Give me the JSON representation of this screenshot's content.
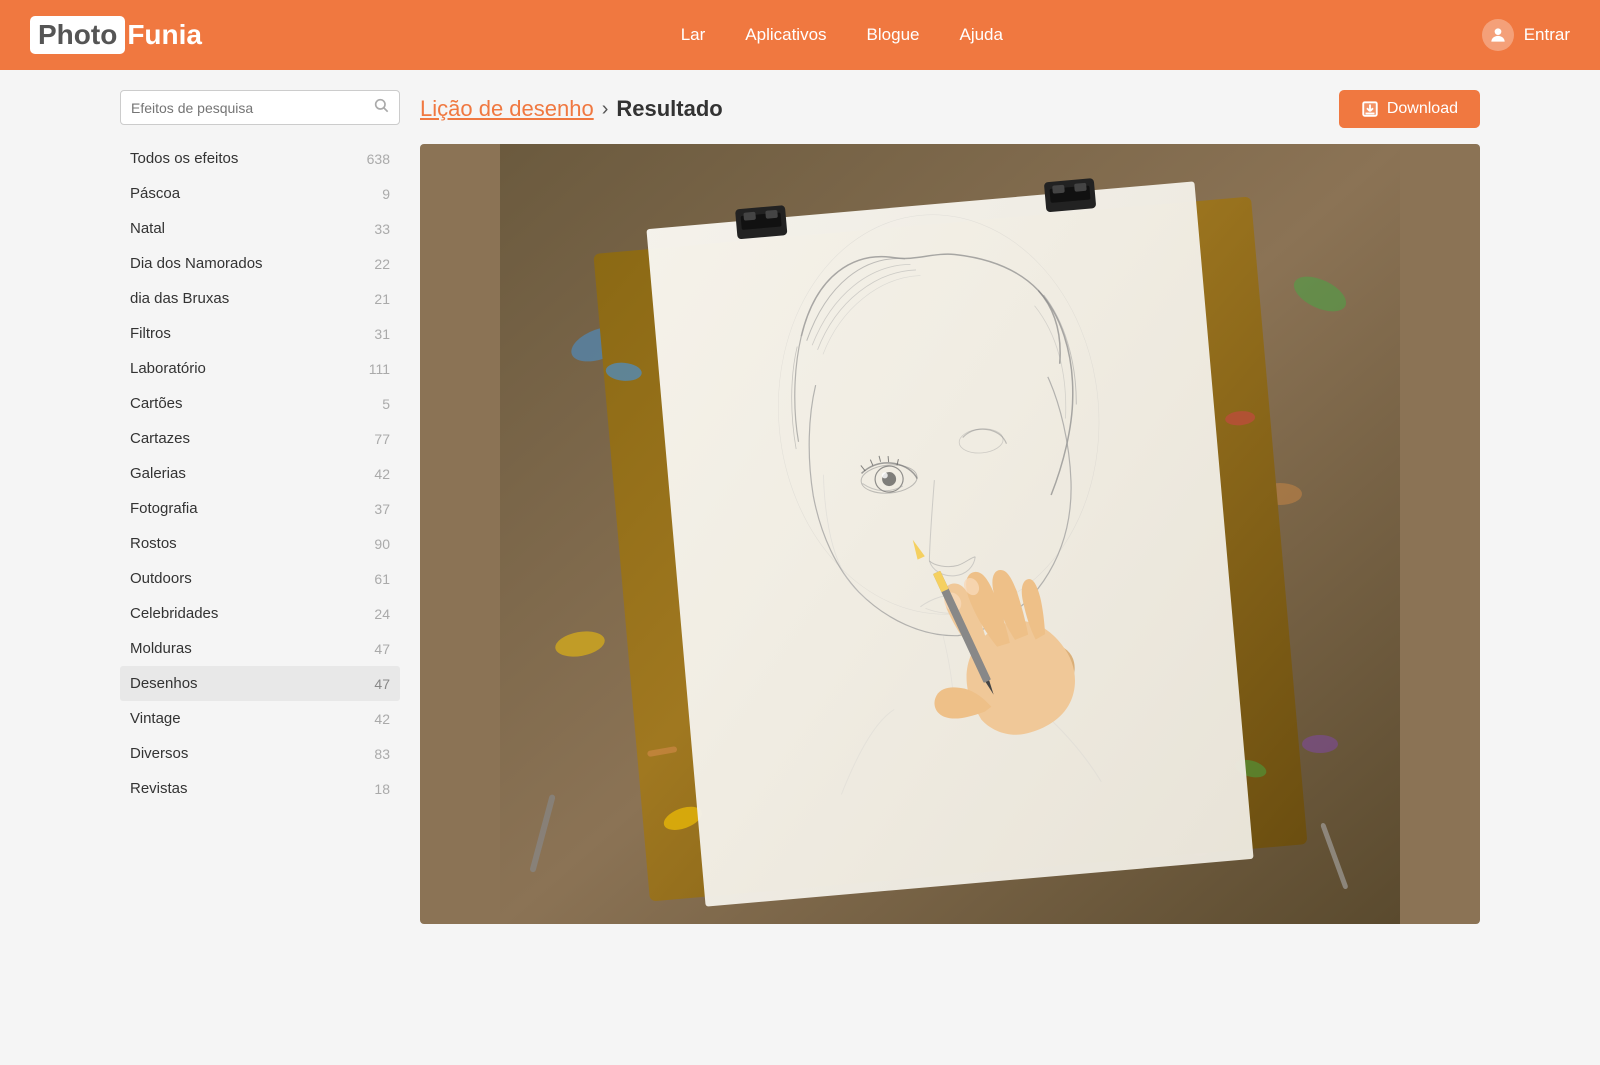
{
  "header": {
    "logo_photo": "Photo",
    "logo_funia": "Funia",
    "nav": [
      {
        "label": "Lar",
        "href": "#"
      },
      {
        "label": "Aplicativos",
        "href": "#"
      },
      {
        "label": "Blogue",
        "href": "#"
      },
      {
        "label": "Ajuda",
        "href": "#"
      }
    ],
    "login_label": "Entrar"
  },
  "search": {
    "placeholder": "Efeitos de pesquisa"
  },
  "sidebar": {
    "items": [
      {
        "label": "Todos os efeitos",
        "count": "638",
        "active": false
      },
      {
        "label": "Páscoa",
        "count": "9",
        "active": false
      },
      {
        "label": "Natal",
        "count": "33",
        "active": false
      },
      {
        "label": "Dia dos Namorados",
        "count": "22",
        "active": false
      },
      {
        "label": "dia das Bruxas",
        "count": "21",
        "active": false
      },
      {
        "label": "Filtros",
        "count": "31",
        "active": false
      },
      {
        "label": "Laboratório",
        "count": "111",
        "active": false
      },
      {
        "label": "Cartões",
        "count": "5",
        "active": false
      },
      {
        "label": "Cartazes",
        "count": "77",
        "active": false
      },
      {
        "label": "Galerias",
        "count": "42",
        "active": false
      },
      {
        "label": "Fotografia",
        "count": "37",
        "active": false
      },
      {
        "label": "Rostos",
        "count": "90",
        "active": false
      },
      {
        "label": "Outdoors",
        "count": "61",
        "active": false
      },
      {
        "label": "Celebridades",
        "count": "24",
        "active": false
      },
      {
        "label": "Molduras",
        "count": "47",
        "active": false
      },
      {
        "label": "Desenhos",
        "count": "47",
        "active": true
      },
      {
        "label": "Vintage",
        "count": "42",
        "active": false
      },
      {
        "label": "Diversos",
        "count": "83",
        "active": false
      },
      {
        "label": "Revistas",
        "count": "18",
        "active": false
      }
    ]
  },
  "breadcrumb": {
    "parent": "Lição de desenho",
    "separator": "›",
    "current": "Resultado"
  },
  "toolbar": {
    "download_label": "Download"
  },
  "colors": {
    "accent": "#f07840",
    "header_bg": "#f07840",
    "active_bg": "#e8e8e8"
  }
}
